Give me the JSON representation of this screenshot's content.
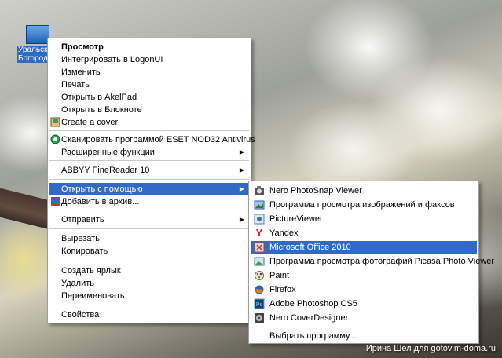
{
  "desktop_icon": {
    "label_line1": "Уральск",
    "label_line2": "Богород"
  },
  "context_menu": {
    "items": [
      {
        "label": "Просмотр"
      },
      {
        "label": "Интегрировать в LogonUI"
      },
      {
        "label": "Изменить"
      },
      {
        "label": "Печать"
      },
      {
        "label": "Открыть в AkelPad"
      },
      {
        "label": "Открыть в Блокноте"
      },
      {
        "label": "Create a cover"
      },
      {
        "label": "Сканировать программой ESET NOD32 Antivirus"
      },
      {
        "label": "Расширенные функции"
      },
      {
        "label": "ABBYY FineReader 10"
      },
      {
        "label": "Открыть с помощью"
      },
      {
        "label": "Добавить в архив..."
      },
      {
        "label": "Отправить"
      },
      {
        "label": "Вырезать"
      },
      {
        "label": "Копировать"
      },
      {
        "label": "Создать ярлык"
      },
      {
        "label": "Удалить"
      },
      {
        "label": "Переименовать"
      },
      {
        "label": "Свойства"
      }
    ]
  },
  "open_with_submenu": {
    "items": [
      {
        "label": "Nero PhotoSnap Viewer"
      },
      {
        "label": "Программа просмотра изображений и факсов"
      },
      {
        "label": "PictureViewer"
      },
      {
        "label": "Yandex"
      },
      {
        "label": "Microsoft Office 2010"
      },
      {
        "label": "Программа просмотра фотографий Picasa Photo Viewer"
      },
      {
        "label": "Paint"
      },
      {
        "label": "Firefox"
      },
      {
        "label": "Adobe Photoshop CS5"
      },
      {
        "label": "Nero CoverDesigner"
      },
      {
        "label": "Выбрать программу..."
      }
    ]
  },
  "watermark": "Ирина Шел для gotovim-doma.ru",
  "colors": {
    "highlight": "#316ac5",
    "menu_bg": "#ffffff"
  },
  "icons": {
    "create_cover": "cover-icon",
    "eset": "eset-icon",
    "archive": "winrar-icon",
    "nero_photosnap": "nero-photosnap-icon",
    "image_fax_viewer": "image-viewer-icon",
    "pictureviewer": "pictureviewer-icon",
    "yandex": "yandex-icon",
    "office": "office-icon",
    "picasa": "picasa-icon",
    "paint": "paint-icon",
    "firefox": "firefox-icon",
    "photoshop": "photoshop-icon",
    "nero_cover": "nero-coverdesigner-icon"
  }
}
